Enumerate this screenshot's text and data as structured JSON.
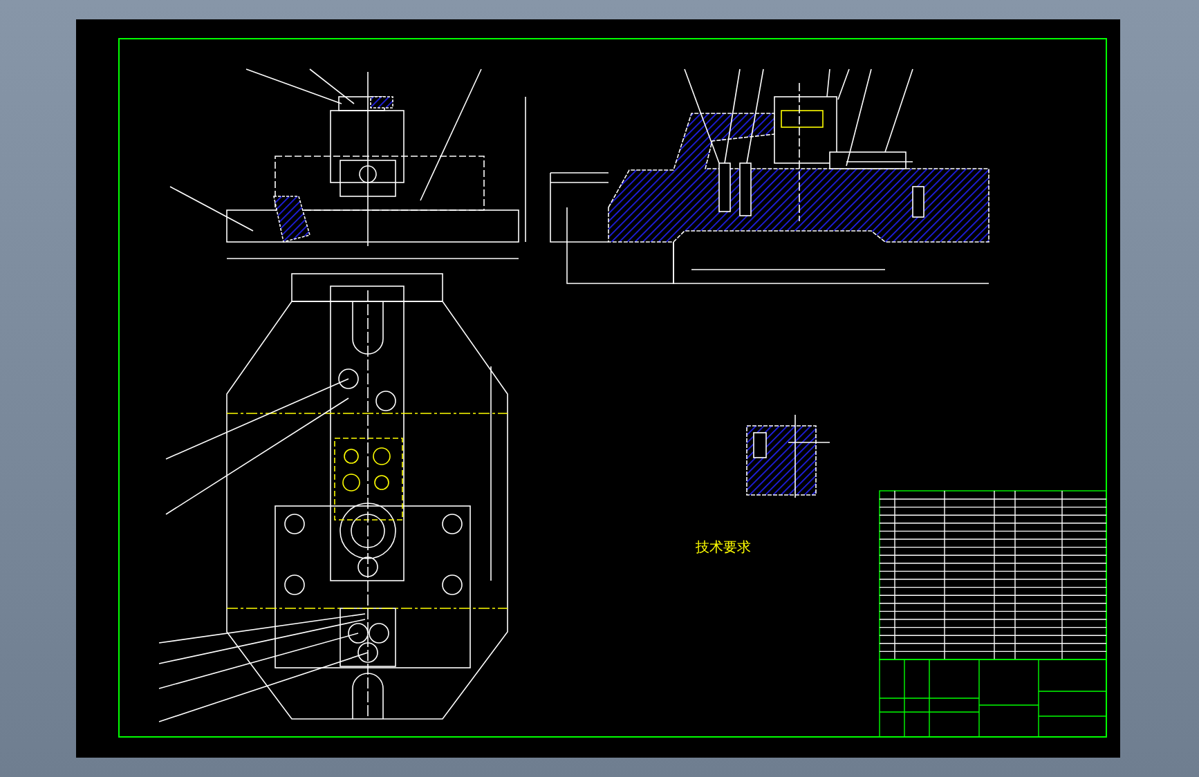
{
  "drawing": {
    "notes_title": "技术要求"
  }
}
